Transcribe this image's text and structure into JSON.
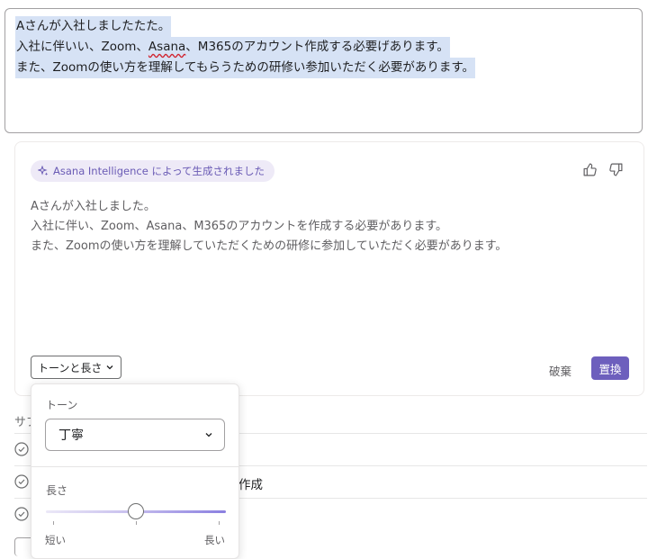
{
  "editor": {
    "lines": [
      "Aさんが入社しましたたた。",
      "入社に伴いい、Zoom、",
      "Asana",
      "、M365のアカウント作成する必要げあります。",
      "また、Zoomの使い方を理解してもらうための研修い参加いただく必要があります。"
    ]
  },
  "ai_panel": {
    "badge": "Asana Intelligence によって生成されました",
    "result_lines": [
      "Aさんが入社しました。",
      "入社に伴い、Zoom、Asana、M365のアカウントを作成する必要があります。",
      "また、Zoomの使い方を理解していただくための研修に参加していただく必要があります。"
    ],
    "tone_button": "トーンと長さ",
    "discard": "破棄",
    "replace": "置換",
    "icons": [
      "sparkle-icon",
      "thumbs-up-icon",
      "thumbs-down-icon",
      "chevron-down-icon"
    ],
    "accent_color": "#6d5fbd"
  },
  "background": {
    "subtask_header": "サブ",
    "subtask_rows": [
      "",
      "作成",
      ""
    ]
  },
  "popover": {
    "tone_label": "トーン",
    "tone_value": "丁寧",
    "length_label": "長さ",
    "length_value": 0.5,
    "length_min": "短い",
    "length_max": "長い"
  }
}
